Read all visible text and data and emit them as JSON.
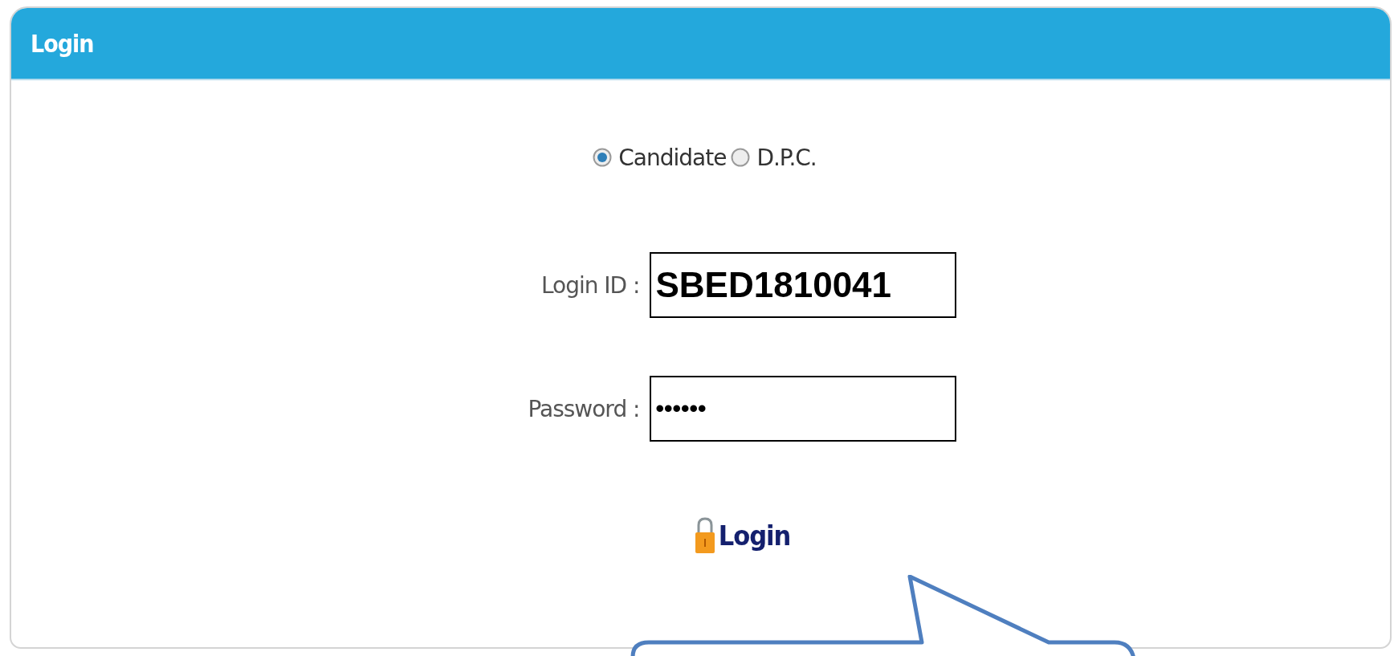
{
  "panel": {
    "title": "Login"
  },
  "user_types": [
    {
      "label": "Candidate",
      "selected": true
    },
    {
      "label": "D.P.C.",
      "selected": false
    }
  ],
  "fields": [
    {
      "kind": "text",
      "label": "Login ID :",
      "value": "SBED1810041"
    },
    {
      "kind": "password",
      "label": "Password :",
      "value": "••••••"
    }
  ],
  "login_button": {
    "label": "Login"
  }
}
